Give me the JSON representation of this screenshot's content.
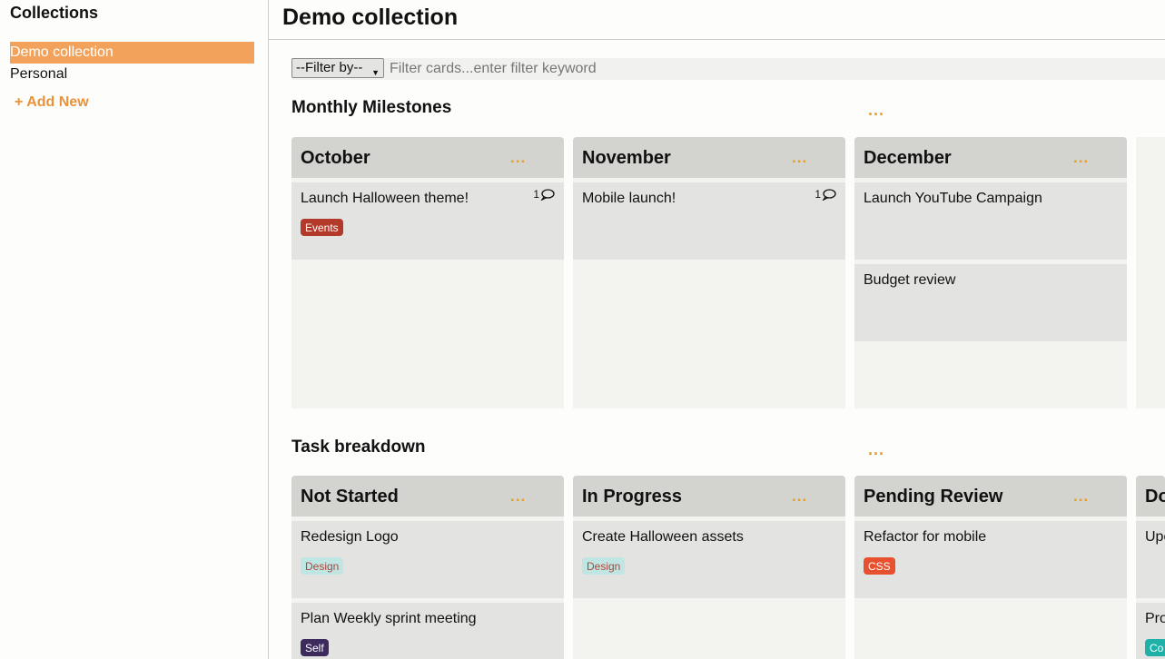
{
  "sidebar": {
    "title": "Collections",
    "items": [
      {
        "label": "Demo collection",
        "active": true
      },
      {
        "label": "Personal",
        "active": false
      }
    ],
    "add_new": "+ Add New"
  },
  "main": {
    "title": "Demo collection",
    "filter": {
      "select_value": "--Filter by--",
      "placeholder": "Filter cards...enter filter keyword"
    },
    "boards": [
      {
        "title": "Monthly Milestones",
        "menu": "...",
        "lists": [
          {
            "title": "October",
            "menu": "...",
            "cards": [
              {
                "title": "Launch Halloween theme!",
                "comments": "1",
                "label": {
                  "text": "Events",
                  "bg": "#b33a2a",
                  "fg": "#ffffff"
                }
              }
            ]
          },
          {
            "title": "November",
            "menu": "...",
            "cards": [
              {
                "title": "Mobile launch!",
                "comments": "1"
              }
            ]
          },
          {
            "title": "December",
            "menu": "...",
            "cards": [
              {
                "title": "Launch YouTube Campaign"
              },
              {
                "title": "Budget review"
              }
            ]
          }
        ]
      },
      {
        "title": "Task breakdown",
        "menu": "...",
        "lists": [
          {
            "title": "Not Started",
            "menu": "...",
            "cards": [
              {
                "title": "Redesign Logo",
                "label": {
                  "text": "Design",
                  "bg": "#bfe6e3",
                  "fg": "#b0443a"
                }
              },
              {
                "title": "Plan Weekly sprint meeting",
                "label": {
                  "text": "Self",
                  "bg": "#3d2b5e",
                  "fg": "#ffffff"
                }
              }
            ]
          },
          {
            "title": "In Progress",
            "menu": "...",
            "cards": [
              {
                "title": "Create Halloween assets",
                "label": {
                  "text": "Design",
                  "bg": "#bfe6e3",
                  "fg": "#b0443a"
                }
              }
            ]
          },
          {
            "title": "Pending Review",
            "menu": "...",
            "cards": [
              {
                "title": "Refactor for mobile",
                "label": {
                  "text": "CSS",
                  "bg": "#e8512f",
                  "fg": "#ffffff"
                }
              }
            ]
          },
          {
            "title": "Do",
            "menu": "...",
            "cards": [
              {
                "title": "Upo"
              },
              {
                "title": "Pro",
                "label": {
                  "text": "Co",
                  "bg": "#1fb1a8",
                  "fg": "#ffffff"
                }
              }
            ]
          }
        ]
      }
    ]
  },
  "colors": {
    "accent": "#f2a25b",
    "menu_dots": "#e8a020",
    "list_header": "#d3d3d0",
    "card_bg": "#e3e3e1"
  }
}
